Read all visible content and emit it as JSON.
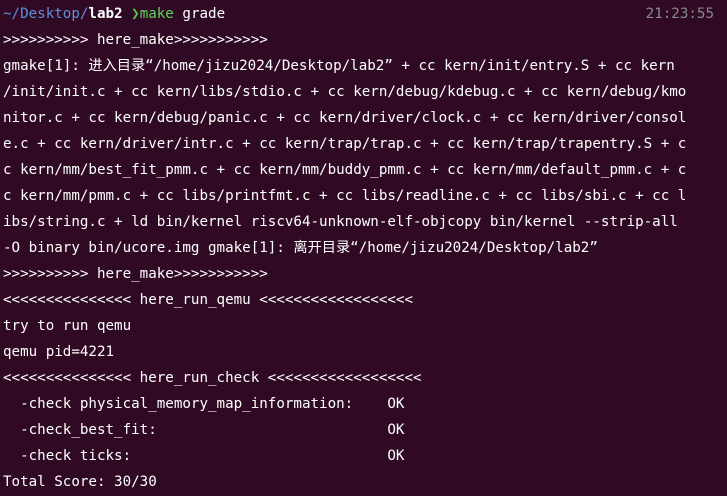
{
  "terminal": {
    "prompt": {
      "path_prefix": "~/Desktop/",
      "path_dir": "lab2",
      "arrow": "❯",
      "command": "make",
      "argument": "grade",
      "time": "21:23:55"
    },
    "lines": [
      ">>>>>>>>>> here_make>>>>>>>>>>>",
      "gmake[1]: 进入目录“/home/jizu2024/Desktop/lab2” + cc kern/init/entry.S + cc kern",
      "/init/init.c + cc kern/libs/stdio.c + cc kern/debug/kdebug.c + cc kern/debug/kmo",
      "nitor.c + cc kern/debug/panic.c + cc kern/driver/clock.c + cc kern/driver/consol",
      "e.c + cc kern/driver/intr.c + cc kern/trap/trap.c + cc kern/trap/trapentry.S + c",
      "c kern/mm/best_fit_pmm.c + cc kern/mm/buddy_pmm.c + cc kern/mm/default_pmm.c + c",
      "c kern/mm/pmm.c + cc libs/printfmt.c + cc libs/readline.c + cc libs/sbi.c + cc l",
      "ibs/string.c + ld bin/kernel riscv64-unknown-elf-objcopy bin/kernel --strip-all",
      "-O binary bin/ucore.img gmake[1]: 离开目录“/home/jizu2024/Desktop/lab2”",
      ">>>>>>>>>> here_make>>>>>>>>>>>",
      "<<<<<<<<<<<<<<< here_run_qemu <<<<<<<<<<<<<<<<<<",
      "try to run qemu",
      "qemu pid=4221",
      "<<<<<<<<<<<<<<< here_run_check <<<<<<<<<<<<<<<<<<",
      "  -check physical_memory_map_information:    OK",
      "  -check_best_fit:                           OK",
      "  -check ticks:                              OK",
      "Total Score: 30/30"
    ]
  }
}
